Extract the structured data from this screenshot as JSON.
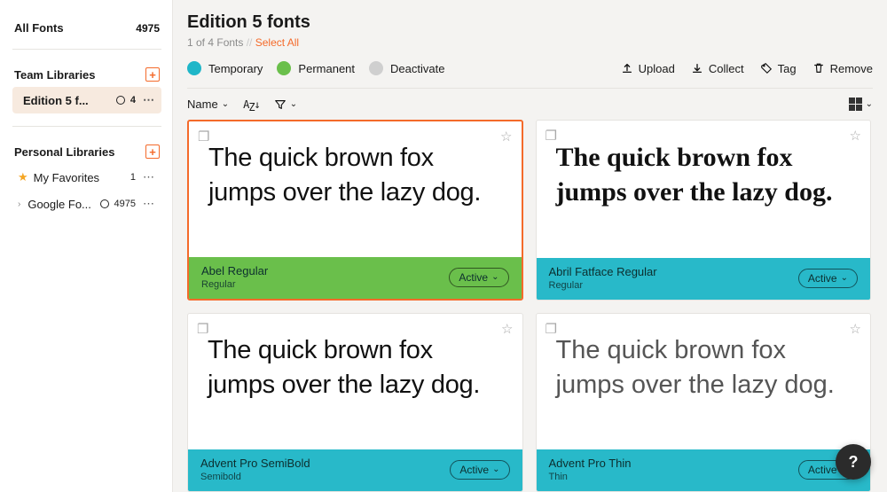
{
  "sidebar": {
    "all_fonts_label": "All Fonts",
    "all_fonts_count": "4975",
    "team_libraries_label": "Team Libraries",
    "team_items": [
      {
        "name": "Edition 5 f...",
        "count": "4"
      }
    ],
    "personal_libraries_label": "Personal Libraries",
    "personal_items": [
      {
        "name": "My Favorites",
        "count": "1",
        "starred": true
      },
      {
        "name": "Google Fo...",
        "count": "4975",
        "starred": false
      }
    ]
  },
  "header": {
    "title": "Edition 5 fonts",
    "subcount": "1 of 4 Fonts",
    "select_all": "Select All",
    "legend": {
      "temporary": "Temporary",
      "permanent": "Permanent",
      "deactivate": "Deactivate"
    },
    "actions": {
      "upload": "Upload",
      "collect": "Collect",
      "tag": "Tag",
      "remove": "Remove"
    }
  },
  "controls": {
    "sort_label": "Name"
  },
  "cards": [
    {
      "preview_text": "The quick brown fox jumps over the lazy dog.",
      "font_name": "Abel Regular",
      "font_style": "Regular",
      "status": "perm",
      "status_label": "Active",
      "selected": true,
      "preview_class": "cond"
    },
    {
      "preview_text": "The quick brown fox jumps over the lazy dog.",
      "font_name": "Abril Fatface Regular",
      "font_style": "Regular",
      "status": "temp",
      "status_label": "Active",
      "selected": false,
      "preview_class": "serif"
    },
    {
      "preview_text": "The quick brown fox jumps over the lazy dog.",
      "font_name": "Advent Pro SemiBold",
      "font_style": "Semibold",
      "status": "temp",
      "status_label": "Active",
      "selected": false,
      "preview_class": "cond"
    },
    {
      "preview_text": "The quick brown fox jumps over the lazy dog.",
      "font_name": "Advent Pro Thin",
      "font_style": "Thin",
      "status": "temp",
      "status_label": "Active",
      "selected": false,
      "preview_class": "light"
    }
  ],
  "help_badge": "?"
}
